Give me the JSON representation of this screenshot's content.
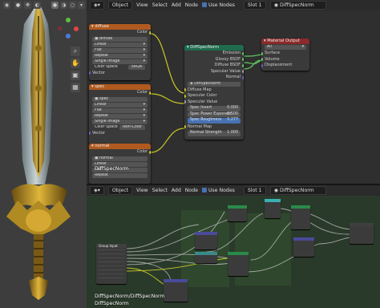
{
  "viewport": {
    "overlay_icons": [
      "search-icon",
      "hand-icon",
      "camera-icon",
      "grid-icon"
    ]
  },
  "top_header": {
    "editor_icon": "node-editor-icon",
    "object_menu": "Object",
    "menus": [
      "View",
      "Select",
      "Add",
      "Node"
    ],
    "use_nodes": "Use Nodes",
    "slot": "Slot 1",
    "material": "DiffSpecNorm"
  },
  "bottom_header": {
    "object_menu": "Object",
    "menus": [
      "View",
      "Select",
      "Add",
      "Node"
    ],
    "use_nodes": "Use Nodes",
    "slot": "Slot 1",
    "material": "DiffSpecNorm"
  },
  "tex_diffuse": {
    "title": "diffuse",
    "color_out": "Color",
    "image": "diffuse",
    "interpolation": "Linear",
    "projection": "Flat",
    "extension": "Repeat",
    "source": "Single Image",
    "color_space_label": "Color Space",
    "color_space": "sRGB",
    "vector_in": "Vector"
  },
  "tex_spec": {
    "title": "spec",
    "color_out": "Color",
    "image": "spec",
    "interpolation": "Linear",
    "projection": "Flat",
    "extension": "Repeat",
    "source": "Single Image",
    "color_space_label": "Color Space",
    "color_space": "Non-Color",
    "vector_in": "Vector"
  },
  "tex_normal": {
    "title": "normal",
    "color_out": "Color",
    "image": "normal",
    "interpolation": "Linear",
    "projection": "Flat",
    "extension": "Repeat"
  },
  "group_node": {
    "title": "DiffSpecNorm",
    "outputs": [
      "Emission",
      "Glossy BSDF",
      "Diffuse BSDF",
      "Specular Value",
      "Normal"
    ],
    "group_name": "DiffSpecNorm",
    "inputs": [
      "Diffuse Map",
      "Specular Color",
      "Specular Value"
    ],
    "spec_invert_label": "Spec Invert",
    "spec_invert_value": "0.000",
    "spec_power_label": "Spec Power Exponent",
    "spec_power_value": "0.500",
    "spec_rough_label": "Spec Roughness",
    "spec_rough_value": "0.277",
    "normal_map_in": "Normal Map",
    "normal_strength_label": "Normal Strength",
    "normal_strength_value": "1.000"
  },
  "material_output": {
    "title": "Material Output",
    "target": "All",
    "inputs": [
      "Surface",
      "Volume",
      "Displacement"
    ]
  },
  "bottom_editor": {
    "group_input_title": "Group Input",
    "frame_label": "DiffSpecNorm/DiffSpecNorm",
    "corner_label": "DiffSpecNorm",
    "overlay_label": "DiffSpecNorm"
  }
}
